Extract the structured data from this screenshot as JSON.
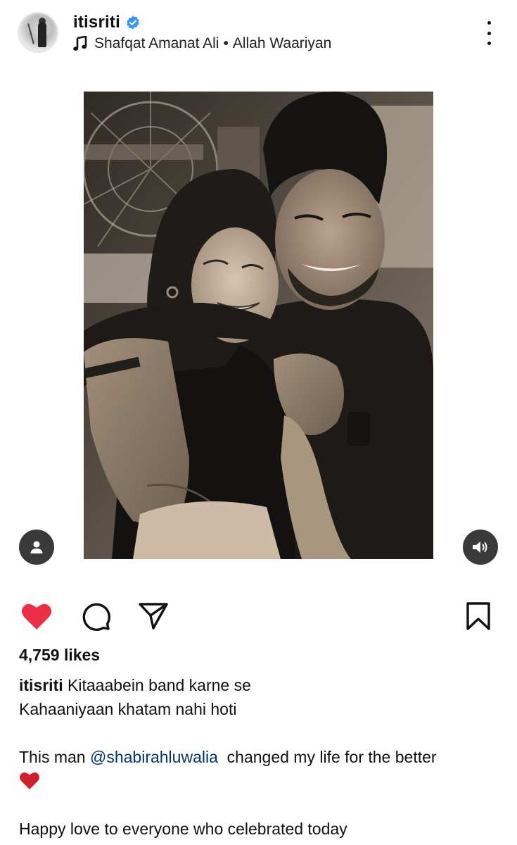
{
  "post": {
    "username": "itisriti",
    "audio": {
      "artist": "Shafqat Amanat Ali",
      "separator": "•",
      "song": "Allah Waariyan"
    }
  },
  "engagement": {
    "likes_text": "4,759 likes",
    "liked": true
  },
  "caption": {
    "username": "itisriti",
    "line1": "Kitaaabein band karne se",
    "line2": "Kahaaniyaan khatam nahi hoti",
    "line3_prefix": "This man",
    "mention": "@shabirahluwalia",
    "line3_suffix": "changed my life for the better",
    "line5": "Happy love to everyone who celebrated today"
  },
  "icons": {
    "verified": "verified-badge-icon",
    "music": "music-note-icon",
    "more": "more-options-icon",
    "tag": "tagged-people-icon",
    "sound": "sound-icon",
    "like": "heart-filled-icon",
    "comment": "comment-icon",
    "share": "share-paper-plane-icon",
    "save": "bookmark-icon",
    "emoji": "red-heart-emoji-icon"
  },
  "colors": {
    "like": "#ed2e45",
    "verified": "#3897f0",
    "mention": "#00376b",
    "emoji_heart": "#d0202e"
  }
}
